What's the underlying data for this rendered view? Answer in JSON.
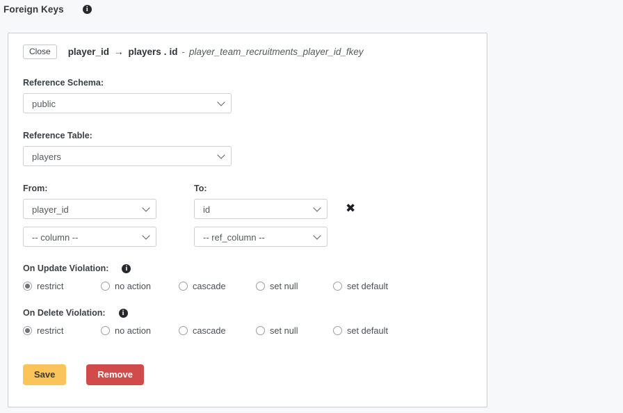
{
  "header": {
    "title": "Foreign Keys",
    "info_icon": "info-icon",
    "info_tooltip": "i"
  },
  "foreign_key": {
    "close_label": "Close",
    "from_column": "player_id",
    "arrow": "→",
    "ref_table": "players",
    "separator": ".",
    "ref_column": "id",
    "dash": "-",
    "constraint_name": "player_team_recruitments_player_id_fkey",
    "reference_schema": {
      "label": "Reference Schema:",
      "value": "public",
      "options": [
        "public"
      ]
    },
    "reference_table": {
      "label": "Reference Table:",
      "value": "players",
      "options": [
        "players"
      ]
    },
    "mapping": {
      "from_label": "From:",
      "to_label": "To:",
      "remove_pair_icon": "✖",
      "rows": [
        {
          "from_value": "player_id",
          "to_value": "id"
        },
        {
          "from_value": "-- column --",
          "to_value": "-- ref_column --"
        }
      ]
    },
    "on_update": {
      "label": "On Update Violation:",
      "info_icon": "info-icon",
      "info_tooltip": "i",
      "selected": "restrict",
      "options": [
        "restrict",
        "no action",
        "cascade",
        "set null",
        "set default"
      ]
    },
    "on_delete": {
      "label": "On Delete Violation:",
      "info_icon": "info-icon",
      "info_tooltip": "i",
      "selected": "restrict",
      "options": [
        "restrict",
        "no action",
        "cascade",
        "set null",
        "set default"
      ]
    },
    "actions": {
      "save_label": "Save",
      "remove_label": "Remove"
    }
  },
  "colors": {
    "page_background": "#f7f8fa",
    "card_background": "#ffffff",
    "card_border": "#c8ccd0",
    "save_button": "#fac45a",
    "remove_button": "#d14b4b",
    "label_text": "#3a3f44",
    "select_text": "#55595e"
  }
}
